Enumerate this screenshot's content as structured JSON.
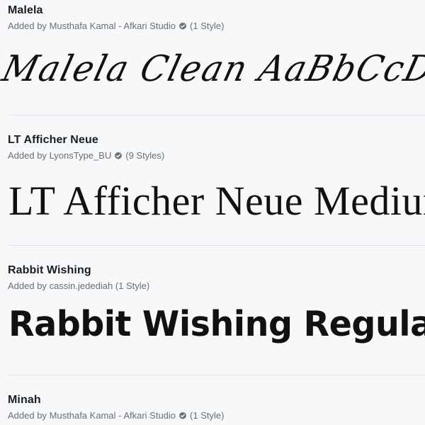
{
  "fonts": [
    {
      "name": "Malela",
      "added_prefix": "Added by",
      "author": "Musthafa Kamal - Afkari Studio",
      "verified": true,
      "styles": "(1 Style)",
      "preview": "Malela Clean AaBbCcDdEeFfGg"
    },
    {
      "name": "LT Afficher Neue",
      "added_prefix": "Added by",
      "author": "LyonsType_BU",
      "verified": true,
      "styles": "(9 Styles)",
      "preview": "LT Afficher Neue Medium"
    },
    {
      "name": "Rabbit Wishing",
      "added_prefix": "Added by",
      "author": "cassin.jedediah",
      "verified": false,
      "styles": "(1 Style)",
      "preview": "Rabbit Wishing Regular A"
    },
    {
      "name": "Minah",
      "added_prefix": "Added by",
      "author": "Musthafa Kamal - Afkari Studio",
      "verified": true,
      "styles": "(1 Style)",
      "preview": ""
    }
  ],
  "icons": {
    "verified": "verified-badge-icon"
  },
  "colors": {
    "background": "#f7f8fa",
    "meta_text": "#6a6f76",
    "divider": "#e1e3e6",
    "verified_badge": "#6a6f76"
  }
}
